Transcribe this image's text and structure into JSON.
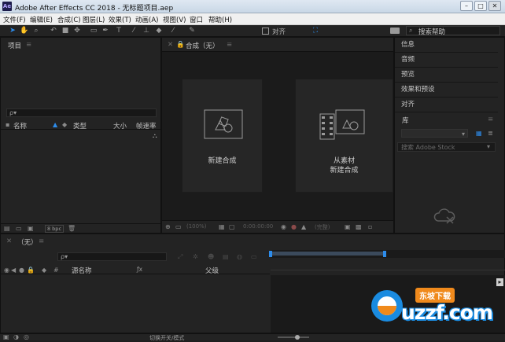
{
  "window": {
    "title": "Adobe After Effects CC 2018 - 无标题项目.aep",
    "logo": "Ae",
    "min": "–",
    "max": "□",
    "close": "✕"
  },
  "menu": [
    "文件(F)",
    "编辑(E)",
    "合成(C)",
    "图层(L)",
    "效果(T)",
    "动画(A)",
    "视图(V)",
    "窗口",
    "帮助(H)"
  ],
  "toolbar": {
    "align_label": "对齐",
    "search_help": "搜索帮助"
  },
  "project": {
    "title": "项目",
    "search_placeholder": "ρ▾",
    "columns": {
      "name": "名称",
      "type": "类型",
      "size": "大小",
      "framerate": "帧速率"
    },
    "bpc": "8 bpc"
  },
  "comp": {
    "tab_title": "合成（无）",
    "new_comp": "新建合成",
    "from_footage_1": "从素材",
    "from_footage_2": "新建合成",
    "zoom": "(100%)",
    "timecode": "0:00:00:00",
    "quality": "(完整)"
  },
  "right_panels": {
    "items": [
      "信息",
      "音频",
      "预览",
      "效果和预设",
      "对齐"
    ],
    "library": "库",
    "search_stock": "搜索 Adobe Stock"
  },
  "timeline": {
    "tab": "（无）",
    "columns": {
      "source_name": "源名称",
      "parent": "父级"
    },
    "switch_modes": "切换开关/模式"
  },
  "watermark": {
    "brand": "uzzf.com",
    "cn": "东坡下载"
  },
  "colors": {
    "accent": "#2d8ceb",
    "panel_bg": "#232323"
  }
}
